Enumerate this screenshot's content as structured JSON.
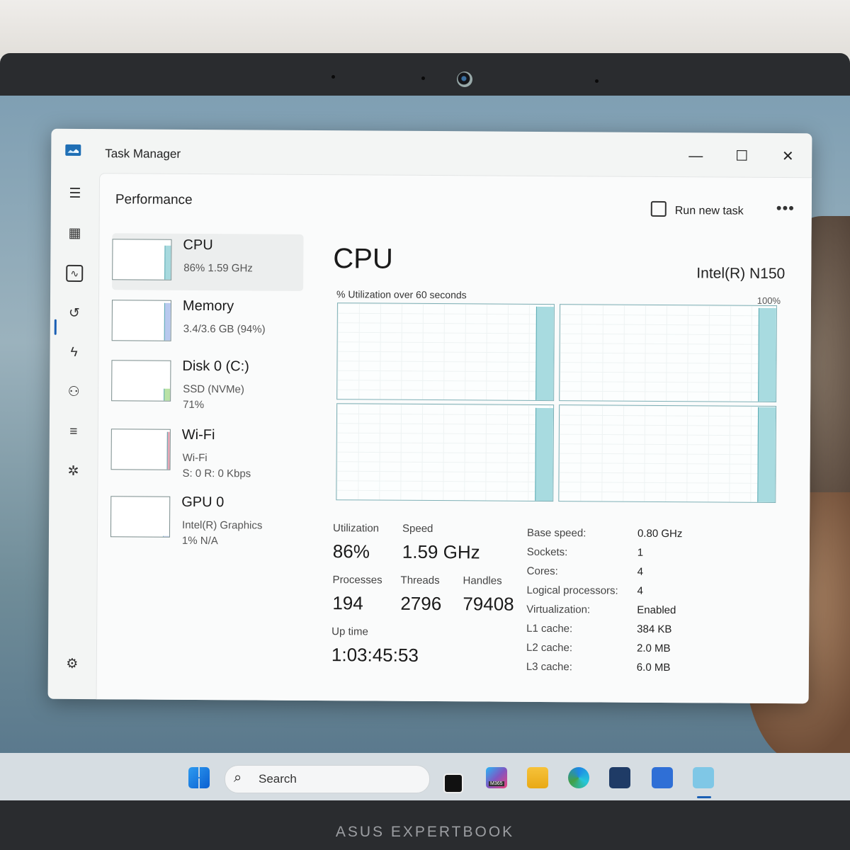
{
  "device": {
    "brand": "ASUS EXPERTBOOK"
  },
  "window": {
    "title": "Task Manager",
    "controls": {
      "minimize": "—",
      "maximize": "☐",
      "close": "✕"
    }
  },
  "page": {
    "heading": "Performance",
    "run_new_task": "Run new task",
    "more": "•••"
  },
  "devices": [
    {
      "name": "CPU",
      "line1": "86% 1.59 GHz",
      "line2": "",
      "level": 0.86,
      "color": "#a7d9de"
    },
    {
      "name": "Memory",
      "line1": "3.4/3.6 GB (94%)",
      "line2": "",
      "level": 0.94,
      "color": "#b8c9ee"
    },
    {
      "name": "Disk 0 (C:)",
      "line1": "SSD (NVMe)",
      "line2": "71%",
      "level": 0.3,
      "color": "#b9e2a6"
    },
    {
      "name": "Wi-Fi",
      "line1": "Wi-Fi",
      "line2": "S: 0 R: 0 Kbps",
      "level": 0.95,
      "color": "#e7a6b5"
    },
    {
      "name": "GPU 0",
      "line1": "Intel(R) Graphics",
      "line2": "1% N/A",
      "level": 0.02,
      "color": "#b8c9ee"
    }
  ],
  "cpu": {
    "title": "CPU",
    "model": "Intel(R) N150",
    "graph_label": "% Utilization over 60 seconds",
    "graph_max": "100%",
    "core_levels": [
      0.98,
      0.98,
      0.97,
      0.99
    ],
    "stats": {
      "utilization_label": "Utilization",
      "utilization": "86%",
      "speed_label": "Speed",
      "speed": "1.59 GHz",
      "processes_label": "Processes",
      "processes": "194",
      "threads_label": "Threads",
      "threads": "2796",
      "handles_label": "Handles",
      "handles": "79408",
      "uptime_label": "Up time",
      "uptime": "1:03:45:53"
    },
    "specs": [
      {
        "k": "Base speed:",
        "v": "0.80 GHz"
      },
      {
        "k": "Sockets:",
        "v": "1"
      },
      {
        "k": "Cores:",
        "v": "4"
      },
      {
        "k": "Logical processors:",
        "v": "4"
      },
      {
        "k": "Virtualization:",
        "v": "Enabled"
      },
      {
        "k": "L1 cache:",
        "v": "384 KB"
      },
      {
        "k": "L2 cache:",
        "v": "2.0 MB"
      },
      {
        "k": "L3 cache:",
        "v": "6.0 MB"
      }
    ]
  },
  "nav": {
    "items": [
      "hamburger-icon",
      "processes-icon",
      "performance-icon",
      "app-history-icon",
      "startup-apps-icon",
      "users-icon",
      "details-icon",
      "services-icon",
      "settings-icon"
    ]
  },
  "taskbar": {
    "search_placeholder": "Search",
    "apps": [
      "start-icon",
      "task-view-icon",
      "m365-icon",
      "file-explorer-icon",
      "edge-icon",
      "store-icon",
      "myasus-icon",
      "task-manager-icon"
    ],
    "m365_badge": "M365"
  }
}
